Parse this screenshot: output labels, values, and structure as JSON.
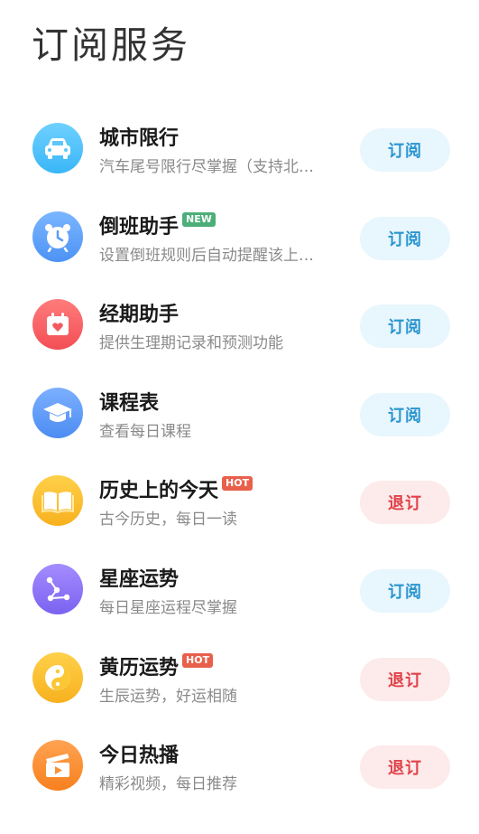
{
  "header": {
    "title": "订阅服务"
  },
  "items": [
    {
      "title": "城市限行",
      "badge": "",
      "subtitle": "汽车尾号限行尽掌握（支持北…",
      "button": "订阅",
      "state": "sub",
      "icon": "car-icon",
      "color_top": "#6fd0ff",
      "color_bottom": "#3ab6f7"
    },
    {
      "title": "倒班助手",
      "badge": "NEW",
      "subtitle": "设置倒班规则后自动提醒该上…",
      "button": "订阅",
      "state": "sub",
      "icon": "alarm-clock-icon",
      "color_top": "#7bb6ff",
      "color_bottom": "#4d93f5"
    },
    {
      "title": "经期助手",
      "badge": "",
      "subtitle": "提供生理期记录和预测功能",
      "button": "订阅",
      "state": "sub",
      "icon": "calendar-heart-icon",
      "color_top": "#ff7c7c",
      "color_bottom": "#f24e55"
    },
    {
      "title": "课程表",
      "badge": "",
      "subtitle": "查看每日课程",
      "button": "订阅",
      "state": "sub",
      "icon": "graduation-cap-icon",
      "color_top": "#7cb0ff",
      "color_bottom": "#4c8cf2"
    },
    {
      "title": "历史上的今天",
      "badge": "HOT",
      "subtitle": "古今历史，每日一读",
      "button": "退订",
      "state": "unsub",
      "icon": "open-book-icon",
      "color_top": "#ffd04a",
      "color_bottom": "#f7b11e"
    },
    {
      "title": "星座运势",
      "badge": "",
      "subtitle": "每日星座运程尽掌握",
      "button": "订阅",
      "state": "sub",
      "icon": "constellation-icon",
      "color_top": "#a48cff",
      "color_bottom": "#7b62f0"
    },
    {
      "title": "黄历运势",
      "badge": "HOT",
      "subtitle": "生辰运势，好运相随",
      "button": "退订",
      "state": "unsub",
      "icon": "yin-yang-icon",
      "color_top": "#ffd04a",
      "color_bottom": "#f7b11e"
    },
    {
      "title": "今日热播",
      "badge": "",
      "subtitle": "精彩视频，每日推荐",
      "button": "退订",
      "state": "unsub",
      "icon": "video-clapper-icon",
      "color_top": "#ffa352",
      "color_bottom": "#f7801e"
    }
  ]
}
